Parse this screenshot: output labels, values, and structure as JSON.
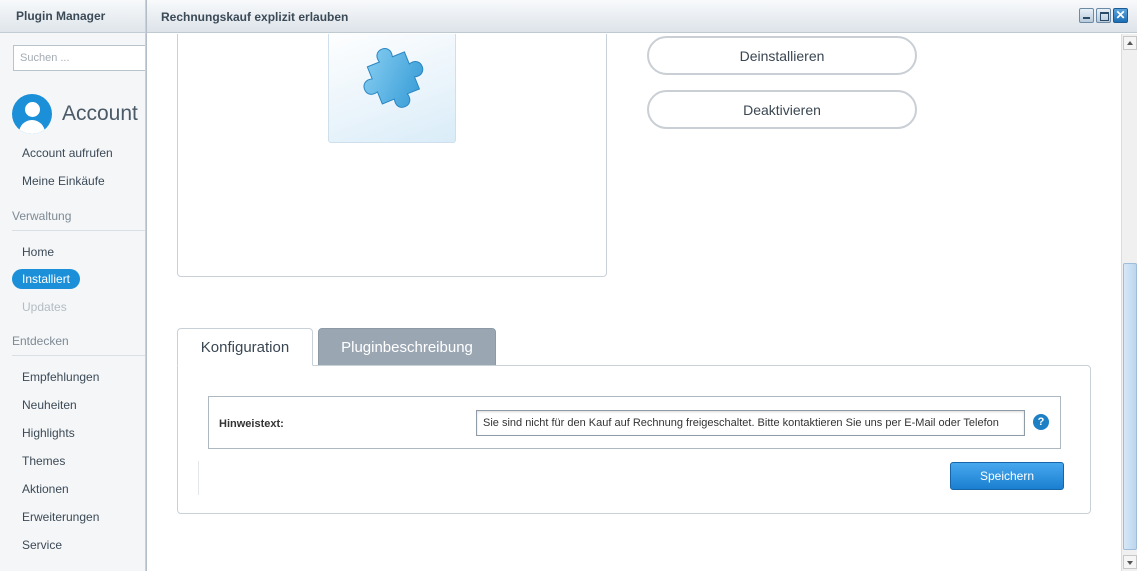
{
  "sidebar": {
    "title": "Plugin Manager",
    "search_placeholder": "Suchen ...",
    "account": {
      "title": "Account",
      "items": [
        "Account aufrufen",
        "Meine Einkäufe"
      ]
    },
    "verwaltung": {
      "heading": "Verwaltung",
      "items": [
        {
          "label": "Home"
        },
        {
          "label": "Installiert",
          "state": "active"
        },
        {
          "label": "Updates",
          "state": "disabled"
        }
      ]
    },
    "entdecken": {
      "heading": "Entdecken",
      "items": [
        "Empfehlungen",
        "Neuheiten",
        "Highlights",
        "Themes",
        "Aktionen",
        "Erweiterungen",
        "Service"
      ]
    },
    "accent_color": "#1b8fd8"
  },
  "window": {
    "title": "Rechnungskauf explizit erlauben",
    "icons": [
      "minimize-icon",
      "maximize-icon",
      "close-icon"
    ],
    "actions": {
      "uninstall_label": "Deinstallieren",
      "deactivate_label": "Deaktivieren"
    },
    "tabs": [
      {
        "label": "Konfiguration",
        "active": true
      },
      {
        "label": "Pluginbeschreibung",
        "active": false
      }
    ],
    "form": {
      "field_label": "Hinweistext:",
      "field_value": "Sie sind nicht für den Kauf auf Rechnung freigeschaltet. Bitte kontaktieren Sie uns per E-Mail oder Telefon",
      "help_symbol": "?",
      "save_label": "Speichern"
    },
    "plugin_icon": "puzzle-icon"
  }
}
